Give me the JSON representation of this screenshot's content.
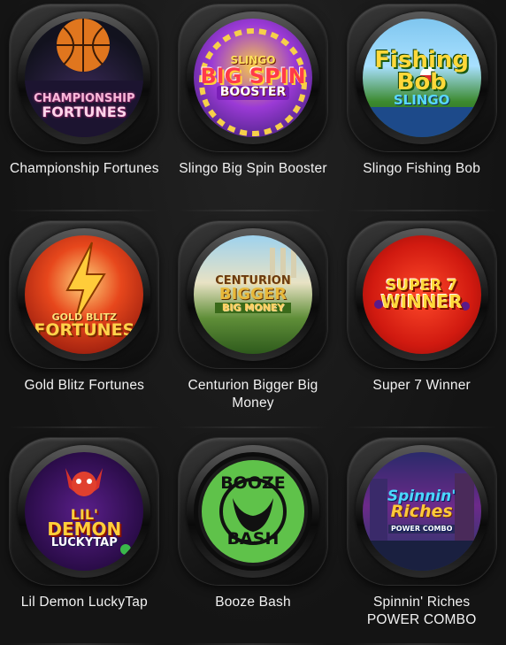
{
  "games": [
    {
      "title": "Championship Fortunes",
      "logo_lines": [
        "CHAMPIONSHIP",
        "FORTUNES"
      ]
    },
    {
      "title": "Slingo Big Spin Booster",
      "logo_lines": [
        "SLINGO",
        "BIG SPIN",
        "BOOSTER"
      ]
    },
    {
      "title": "Slingo Fishing Bob",
      "logo_lines": [
        "Fishing",
        "Bob",
        "SLINGO"
      ]
    },
    {
      "title": "Gold Blitz Fortunes",
      "logo_lines": [
        "GOLD BLITZ",
        "FORTUNES"
      ]
    },
    {
      "title": "Centurion Bigger Big Money",
      "logo_lines": [
        "CENTURION",
        "BIGGER",
        "BIG MONEY"
      ]
    },
    {
      "title": "Super 7 Winner",
      "logo_lines": [
        "SUPER 7",
        "WINNER"
      ]
    },
    {
      "title": "Lil Demon LuckyTap",
      "logo_lines": [
        "LIL'",
        "DEMON",
        "LUCKYTAP"
      ]
    },
    {
      "title": "Booze Bash",
      "logo_lines": [
        "BOOZE",
        "BASH"
      ]
    },
    {
      "title": "Spinnin' Riches POWER COMBO",
      "logo_lines": [
        "Spinnin'",
        "Riches",
        "POWER COMBO"
      ]
    }
  ],
  "colors": {
    "background": "#161616",
    "caption": "#f2f2f2"
  }
}
